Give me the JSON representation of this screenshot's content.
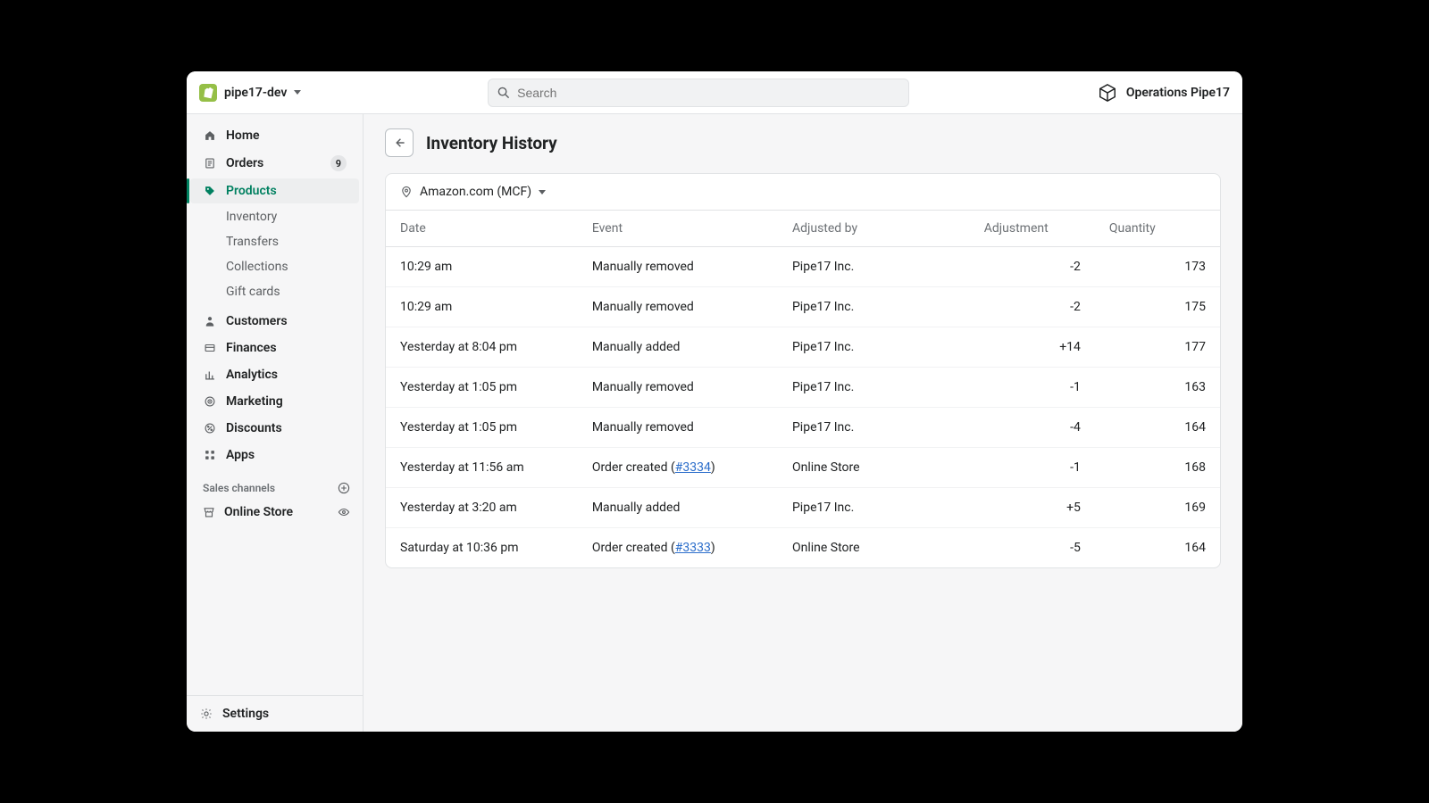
{
  "topbar": {
    "store_name": "pipe17-dev",
    "search_placeholder": "Search",
    "account_name": "Operations Pipe17"
  },
  "sidebar": {
    "items": [
      {
        "label": "Home",
        "icon": "home",
        "active": false
      },
      {
        "label": "Orders",
        "icon": "orders",
        "badge": "9",
        "active": false
      },
      {
        "label": "Products",
        "icon": "products",
        "active": true
      },
      {
        "label": "Customers",
        "icon": "customers",
        "active": false
      },
      {
        "label": "Finances",
        "icon": "finances",
        "active": false
      },
      {
        "label": "Analytics",
        "icon": "analytics",
        "active": false
      },
      {
        "label": "Marketing",
        "icon": "marketing",
        "active": false
      },
      {
        "label": "Discounts",
        "icon": "discounts",
        "active": false
      },
      {
        "label": "Apps",
        "icon": "apps",
        "active": false
      }
    ],
    "products_sub": [
      {
        "label": "Inventory"
      },
      {
        "label": "Transfers"
      },
      {
        "label": "Collections"
      },
      {
        "label": "Gift cards"
      }
    ],
    "sales_channels_header": "Sales channels",
    "channels": [
      {
        "label": "Online Store"
      }
    ],
    "settings_label": "Settings"
  },
  "page": {
    "title": "Inventory History",
    "location": "Amazon.com (MCF)"
  },
  "table": {
    "headers": {
      "date": "Date",
      "event": "Event",
      "adjusted_by": "Adjusted by",
      "adjustment": "Adjustment",
      "quantity": "Quantity"
    },
    "rows": [
      {
        "date": "10:29 am",
        "event_type": "text",
        "event_text": "Manually removed",
        "adjusted_by": "Pipe17 Inc.",
        "adjustment": "-2",
        "adj_sign": "neg",
        "quantity": "173"
      },
      {
        "date": "10:29 am",
        "event_type": "text",
        "event_text": "Manually removed",
        "adjusted_by": "Pipe17 Inc.",
        "adjustment": "-2",
        "adj_sign": "neg",
        "quantity": "175"
      },
      {
        "date": "Yesterday at 8:04 pm",
        "event_type": "text",
        "event_text": "Manually added",
        "adjusted_by": "Pipe17 Inc.",
        "adjustment": "+14",
        "adj_sign": "pos",
        "quantity": "177"
      },
      {
        "date": "Yesterday at 1:05 pm",
        "event_type": "text",
        "event_text": "Manually removed",
        "adjusted_by": "Pipe17 Inc.",
        "adjustment": "-1",
        "adj_sign": "neg",
        "quantity": "163"
      },
      {
        "date": "Yesterday at 1:05 pm",
        "event_type": "text",
        "event_text": "Manually removed",
        "adjusted_by": "Pipe17 Inc.",
        "adjustment": "-4",
        "adj_sign": "neg",
        "quantity": "164"
      },
      {
        "date": "Yesterday at 11:56 am",
        "event_type": "order",
        "event_prefix": "Order created (",
        "order_label": "#3334",
        "event_suffix": ")",
        "adjusted_by": "Online Store",
        "adjustment": "-1",
        "adj_sign": "neg",
        "quantity": "168"
      },
      {
        "date": "Yesterday at 3:20 am",
        "event_type": "text",
        "event_text": "Manually added",
        "adjusted_by": "Pipe17 Inc.",
        "adjustment": "+5",
        "adj_sign": "pos",
        "quantity": "169"
      },
      {
        "date": "Saturday at 10:36 pm",
        "event_type": "order",
        "event_prefix": "Order created (",
        "order_label": "#3333",
        "event_suffix": ")",
        "adjusted_by": "Online Store",
        "adjustment": "-5",
        "adj_sign": "neg",
        "quantity": "164"
      }
    ]
  }
}
